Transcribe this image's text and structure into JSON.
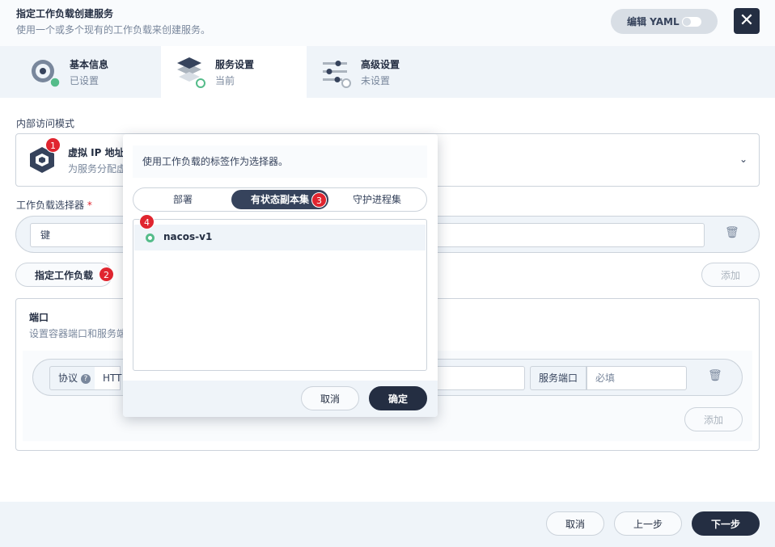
{
  "header": {
    "title": "指定工作负载创建服务",
    "description": "使用一个或多个现有的工作负载来创建服务。",
    "yaml_label": "编辑 YAML"
  },
  "steps": [
    {
      "name": "基本信息",
      "state": "已设置"
    },
    {
      "name": "服务设置",
      "state": "当前"
    },
    {
      "name": "高级设置",
      "state": "未设置"
    }
  ],
  "access_mode": {
    "label": "内部访问模式",
    "name": "虚拟 IP 地址",
    "description_visible": "为服务分配虚"
  },
  "selector": {
    "label": "工作负载选择器",
    "required_mark": "*",
    "key_placeholder": "键",
    "specify_button": "指定工作负载",
    "add_button": "添加"
  },
  "ports": {
    "title": "端口",
    "description_visible": "设置容器端口和服务端",
    "protocol_label": "协议",
    "protocol_value": "HTT",
    "service_port_label": "服务端口",
    "service_port_placeholder": "必填",
    "add_button": "添加"
  },
  "footer": {
    "cancel": "取消",
    "prev": "上一步",
    "next": "下一步"
  },
  "dropdown": {
    "hint": "使用工作负载的标签作为选择器。",
    "tabs": [
      "部署",
      "有状态副本集",
      "守护进程集"
    ],
    "active_tab": 1,
    "items": [
      "nacos-v1"
    ],
    "cancel": "取消",
    "confirm": "确定"
  },
  "badges": [
    "1",
    "2",
    "3",
    "4"
  ],
  "colors": {
    "primary_dark": "#242e42",
    "success": "#55bc8a",
    "badge": "#e0252f"
  }
}
